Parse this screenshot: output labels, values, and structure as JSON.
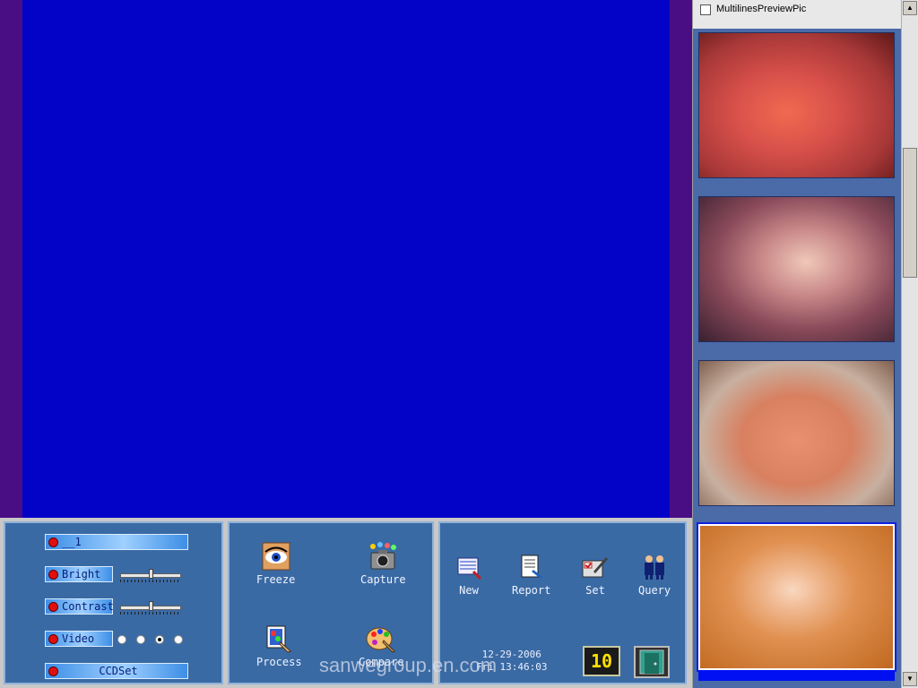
{
  "controls": {
    "channel_label": "__1",
    "bright_label": "Bright",
    "contrast_label": "Contrast",
    "video_label": "Video",
    "ccdset_label": "CCDSet",
    "bright_level": 0.5,
    "contrast_level": 0.5,
    "video_selected_index": 2
  },
  "tools": {
    "freeze": "Freeze",
    "capture": "Capture",
    "process": "Process",
    "compare": "Compare"
  },
  "actions": {
    "new": "New",
    "report": "Report",
    "set": "Set",
    "query": "Query"
  },
  "status": {
    "date": "12-29-2006",
    "time": "Fri 13:46:03",
    "count": "10"
  },
  "preview": {
    "title": "MultilinesPreviewPic",
    "checkbox_checked": false,
    "selected_index": 3
  },
  "watermark": "sanwegroup.en.com",
  "colors": {
    "video_bg": "#0303c8",
    "panel_bg": "#3a6aa4",
    "led": "#e01010",
    "selection": "#0010f0"
  }
}
